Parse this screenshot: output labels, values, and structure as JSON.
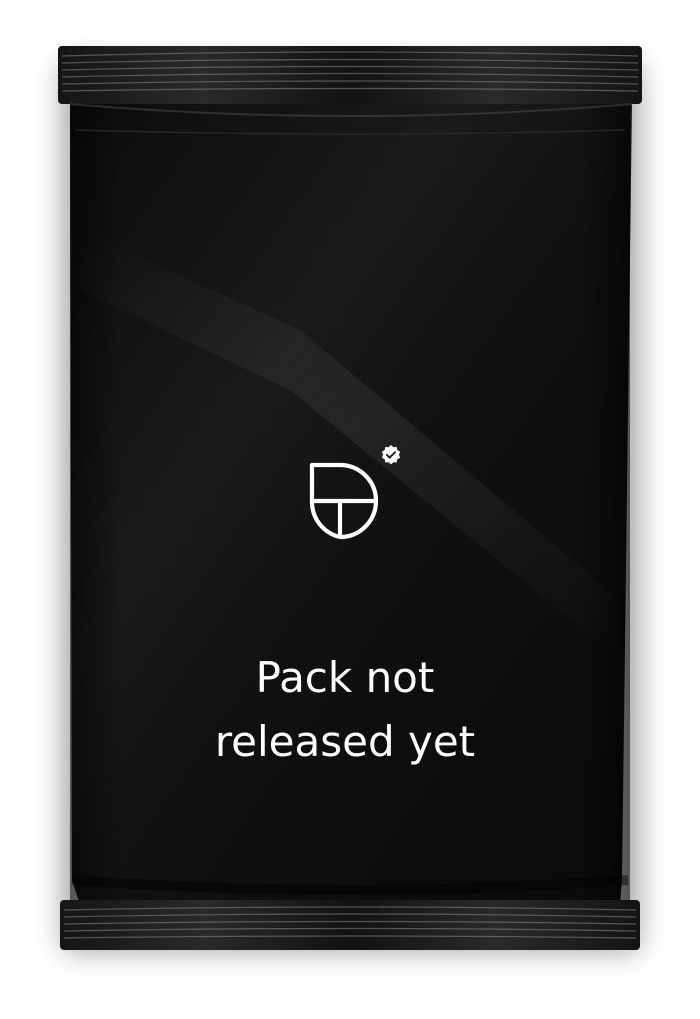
{
  "pack": {
    "message_line_1": "Pack not",
    "message_line_2": "released yet",
    "logo_icon": "pack-brand-logo-icon",
    "verified_badge_icon": "verified-check-icon",
    "colors": {
      "pack_body": "#141414",
      "text": "#ffffff",
      "background": "#ffffff"
    }
  }
}
